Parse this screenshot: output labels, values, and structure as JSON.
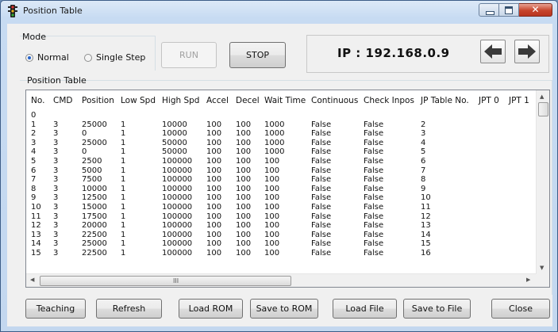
{
  "window": {
    "title": "Position Table"
  },
  "mode": {
    "label": "Mode",
    "options": [
      "Normal",
      "Single Step"
    ],
    "selected": "Normal"
  },
  "controls": {
    "run_label": "RUN",
    "stop_label": "STOP"
  },
  "ip": {
    "text": "IP : 192.168.0.9"
  },
  "nav": {
    "prev_icon": "arrow-left-icon",
    "next_icon": "arrow-right-icon"
  },
  "table": {
    "label": "Position Table",
    "columns": [
      "No.",
      "CMD",
      "Position",
      "Low Spd",
      "High Spd",
      "Accel",
      "Decel",
      "Wait Time",
      "Continuous",
      "Check Inpos",
      "JP Table No.",
      "JPT 0",
      "JPT 1"
    ],
    "rows": [
      [
        "0",
        "",
        "",
        "",
        "",
        "",
        "",
        "",
        "",
        "",
        "",
        "",
        ""
      ],
      [
        "1",
        "3",
        "25000",
        "1",
        "10000",
        "100",
        "100",
        "1000",
        "False",
        "False",
        "2",
        "",
        ""
      ],
      [
        "2",
        "3",
        "0",
        "1",
        "10000",
        "100",
        "100",
        "1000",
        "False",
        "False",
        "3",
        "",
        ""
      ],
      [
        "3",
        "3",
        "25000",
        "1",
        "50000",
        "100",
        "100",
        "1000",
        "False",
        "False",
        "4",
        "",
        ""
      ],
      [
        "4",
        "3",
        "0",
        "1",
        "50000",
        "100",
        "100",
        "1000",
        "False",
        "False",
        "5",
        "",
        ""
      ],
      [
        "5",
        "3",
        "2500",
        "1",
        "100000",
        "100",
        "100",
        "100",
        "False",
        "False",
        "6",
        "",
        ""
      ],
      [
        "6",
        "3",
        "5000",
        "1",
        "100000",
        "100",
        "100",
        "100",
        "False",
        "False",
        "7",
        "",
        ""
      ],
      [
        "7",
        "3",
        "7500",
        "1",
        "100000",
        "100",
        "100",
        "100",
        "False",
        "False",
        "8",
        "",
        ""
      ],
      [
        "8",
        "3",
        "10000",
        "1",
        "100000",
        "100",
        "100",
        "100",
        "False",
        "False",
        "9",
        "",
        ""
      ],
      [
        "9",
        "3",
        "12500",
        "1",
        "100000",
        "100",
        "100",
        "100",
        "False",
        "False",
        "10",
        "",
        ""
      ],
      [
        "10",
        "3",
        "15000",
        "1",
        "100000",
        "100",
        "100",
        "100",
        "False",
        "False",
        "11",
        "",
        ""
      ],
      [
        "11",
        "3",
        "17500",
        "1",
        "100000",
        "100",
        "100",
        "100",
        "False",
        "False",
        "12",
        "",
        ""
      ],
      [
        "12",
        "3",
        "20000",
        "1",
        "100000",
        "100",
        "100",
        "100",
        "False",
        "False",
        "13",
        "",
        ""
      ],
      [
        "13",
        "3",
        "22500",
        "1",
        "100000",
        "100",
        "100",
        "100",
        "False",
        "False",
        "14",
        "",
        ""
      ],
      [
        "14",
        "3",
        "25000",
        "1",
        "100000",
        "100",
        "100",
        "100",
        "False",
        "False",
        "15",
        "",
        ""
      ],
      [
        "15",
        "3",
        "22500",
        "1",
        "100000",
        "100",
        "100",
        "100",
        "False",
        "False",
        "16",
        "",
        ""
      ]
    ]
  },
  "footer": {
    "teaching": "Teaching",
    "refresh": "Refresh",
    "load_rom": "Load ROM",
    "save_rom": "Save to ROM",
    "load_file": "Load File",
    "save_file": "Save to File",
    "close": "Close"
  },
  "scrollbar": {
    "grip": "III"
  },
  "colors": {
    "title_bar": "#c7dbf2",
    "close_button": "#c7442c",
    "radio_selected": "#2663c9"
  }
}
